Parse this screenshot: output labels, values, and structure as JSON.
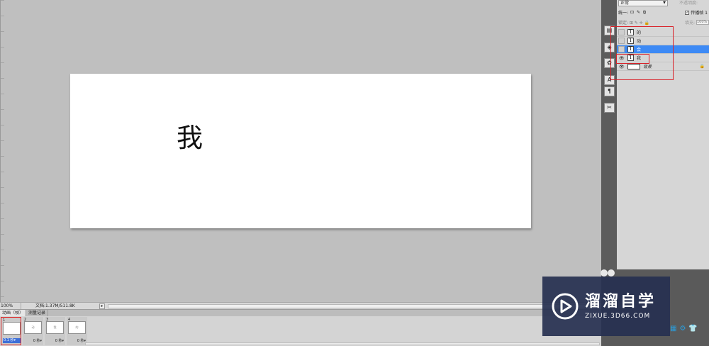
{
  "canvas": {
    "text": "我"
  },
  "status_bar": {
    "zoom": "100%",
    "doc_info": "文档:1.37M/511.8K",
    "arrow": "▸"
  },
  "animation_panel": {
    "tabs": [
      "动画（帧）",
      "测量记录"
    ],
    "frames": [
      {
        "number": "1",
        "thumb": "",
        "delay": "0.1 秒▾"
      },
      {
        "number": "2",
        "thumb": "动",
        "delay": "0 秒▾"
      },
      {
        "number": "3",
        "thumb": "我",
        "delay": "0 秒▾"
      },
      {
        "number": "4",
        "thumb": "的",
        "delay": "0 秒▾"
      }
    ]
  },
  "layers_panel": {
    "blend_mode": "正常",
    "opacity_label": "不透明度:",
    "unify_label": "统一:",
    "unify_icons": "⊡ ✎ ⧉",
    "propagate_label": "传播帧 1",
    "lock_label": "锁定: ⊞ ✎ ✛ 🔒",
    "fill_label": "填充:",
    "fill_value": "100%",
    "layers": [
      {
        "name": "的",
        "visible": false,
        "selected": false,
        "kind": "text",
        "thumb": "T"
      },
      {
        "name": "动",
        "visible": false,
        "selected": false,
        "kind": "text",
        "thumb": "T"
      },
      {
        "name": "会",
        "visible": false,
        "selected": true,
        "kind": "text",
        "thumb": "T"
      },
      {
        "name": "我",
        "visible": true,
        "selected": false,
        "kind": "text",
        "thumb": "T"
      },
      {
        "name": "背景",
        "visible": true,
        "selected": false,
        "kind": "background",
        "thumb": ""
      }
    ],
    "eye_glyph": "👁",
    "lock_glyph": "🔒"
  },
  "icon_strip": {
    "icons": [
      "▤",
      "◈",
      "✿",
      "A",
      "¶",
      "✂"
    ]
  },
  "watermark": {
    "title": "溜溜自学",
    "subtitle": "ZIXUE.3D66.COM"
  },
  "dock_bottom": {
    "icons": [
      "▦",
      "⚙",
      "👕"
    ]
  }
}
